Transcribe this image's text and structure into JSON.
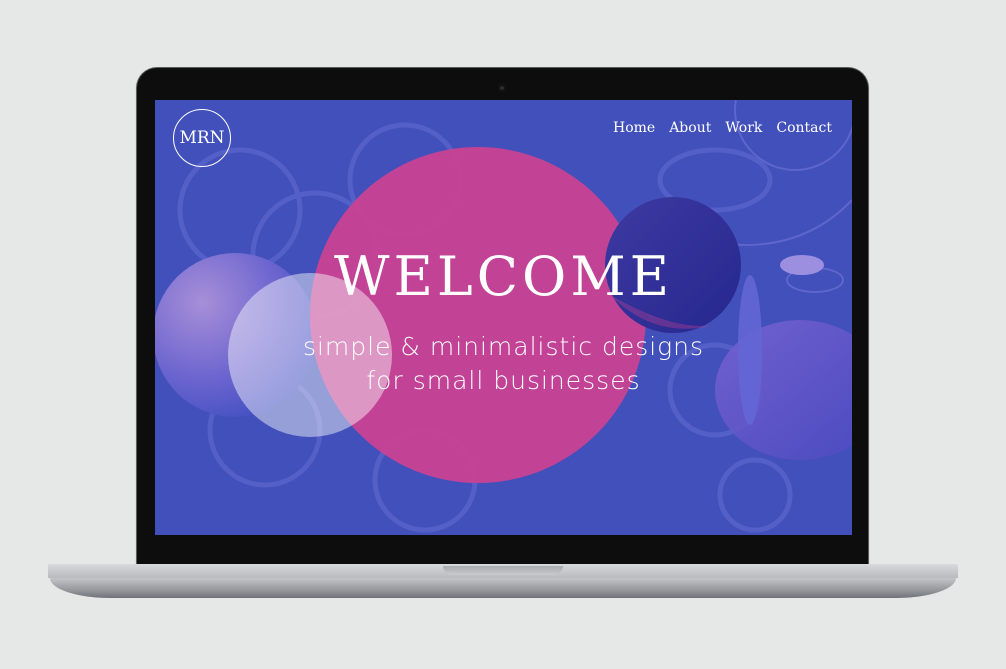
{
  "logo": {
    "text": "MRN"
  },
  "nav": {
    "items": [
      {
        "label": "Home"
      },
      {
        "label": "About"
      },
      {
        "label": "Work"
      },
      {
        "label": "Contact"
      }
    ]
  },
  "hero": {
    "headline": "WELCOME",
    "tagline_line1": "simple & minimalistic designs",
    "tagline_line2": "for small businesses"
  },
  "colors": {
    "background": "#4250bb",
    "accent_pink": "#c94294",
    "text": "#ffffff"
  }
}
